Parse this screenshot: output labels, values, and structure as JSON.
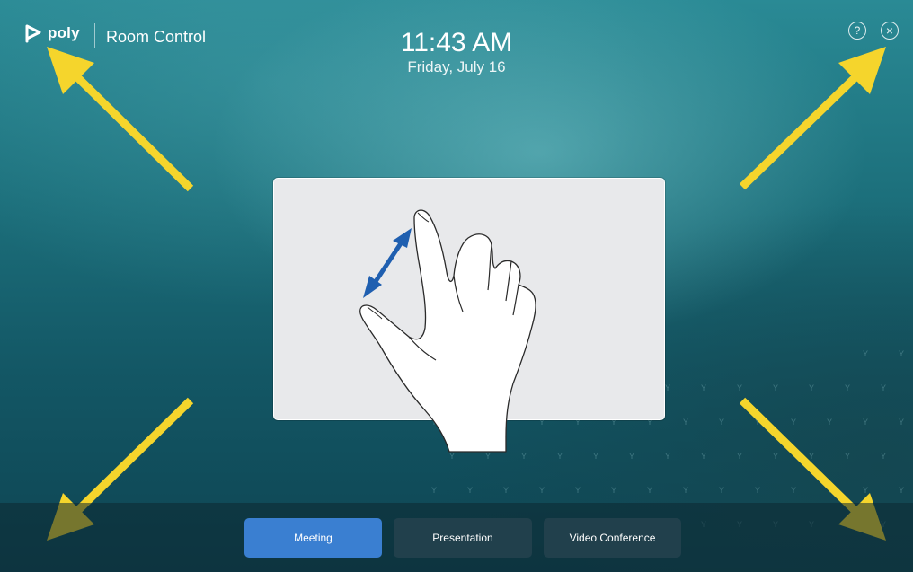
{
  "header": {
    "brand": "poly",
    "app_title": "Room Control",
    "time": "11:43 AM",
    "date": "Friday, July 16",
    "help_symbol": "?",
    "close_symbol": "×"
  },
  "icons": {
    "logo": "poly-logo-icon",
    "help": "help-circle-icon",
    "close": "close-circle-icon",
    "gesture": "pinch-zoom-hand-icon"
  },
  "modes": [
    {
      "label": "Meeting",
      "active": true
    },
    {
      "label": "Presentation",
      "active": false
    },
    {
      "label": "Video Conference",
      "active": false
    }
  ],
  "colors": {
    "accent": "#3a7fd1",
    "arrow": "#f5d52c",
    "gesture_arrow": "#1f5fb0",
    "inactive_button": "#21404c"
  }
}
